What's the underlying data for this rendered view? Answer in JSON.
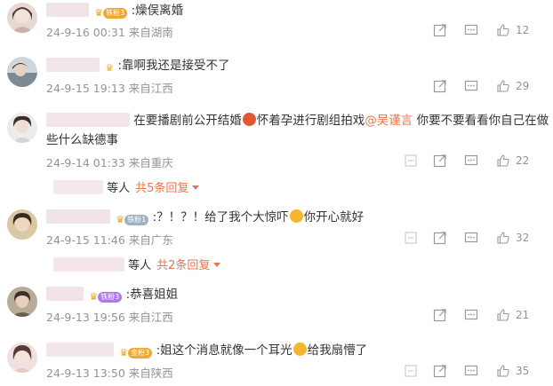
{
  "comments": [
    {
      "text": ":燥俣离婚",
      "badge_label": "铁粉3",
      "date": "24-9-16 00:31",
      "location": "来自湖南",
      "likes": "12"
    },
    {
      "text": ":靠啊我还是接受不了",
      "date": "24-9-15 19:13",
      "location": "来自江西",
      "likes": "29"
    },
    {
      "text_before": "在要播剧前公开结婚",
      "text_middle": "怀着孕进行剧组拍戏",
      "mention": "@吴谨言",
      "text_after": " 你要不要看看你自己在做",
      "text_line2": "些什么缺德事",
      "date": "24-9-14 01:33",
      "location": "来自重庆",
      "likes": "22",
      "reply_people": "等人",
      "reply_count": "共5条回复"
    },
    {
      "text_before": ":？！？！给了我个大惊吓",
      "text_after": "你开心就好",
      "badge_label": "铁粉1",
      "date": "24-9-15 11:46",
      "location": "来自广东",
      "likes": "32",
      "reply_people": "等人",
      "reply_count": "共2条回复"
    },
    {
      "text": ":恭喜姐姐",
      "badge_label": "铁粉3",
      "date": "24-9-13 19:56",
      "location": "来自江西",
      "likes": "21"
    },
    {
      "text_before": ":姐这个消息就像一个耳光",
      "text_after": "给我扇懵了",
      "badge_label": "金粉3",
      "date": "24-9-13 13:50",
      "location": "来自陕西",
      "likes": "35"
    }
  ]
}
